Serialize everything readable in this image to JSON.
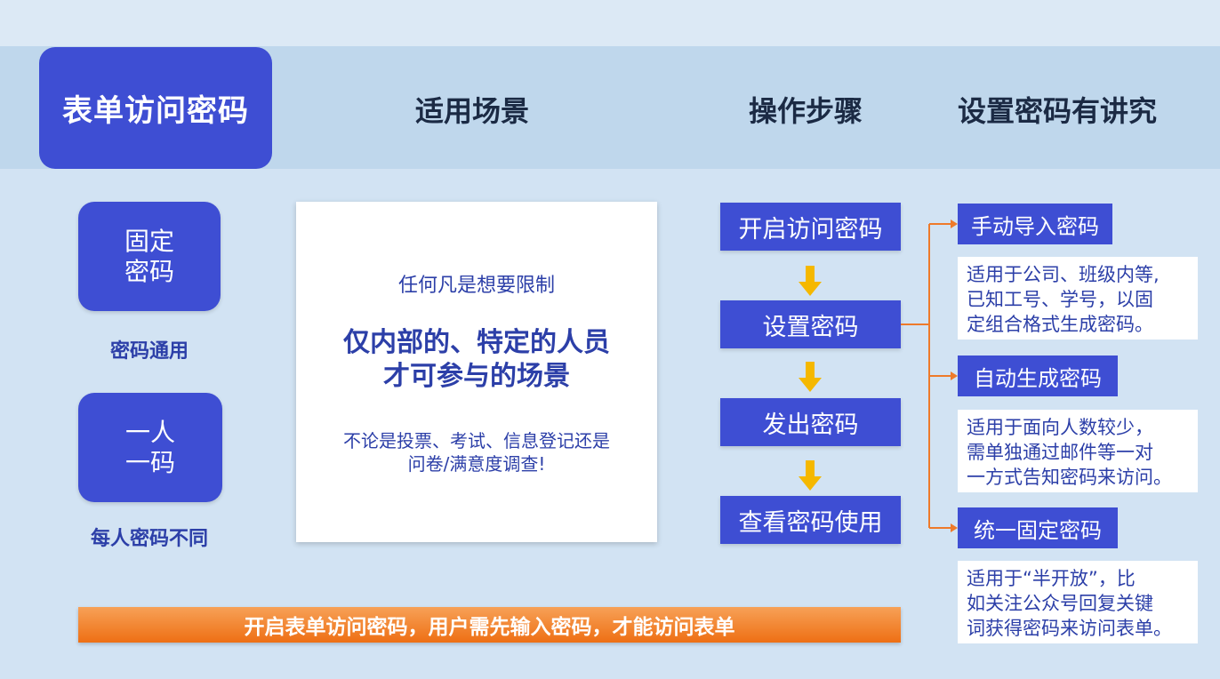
{
  "header": {
    "title": "表单访问密码",
    "columns": [
      "适用场景",
      "操作步骤",
      "设置密码有讲究"
    ]
  },
  "types": [
    {
      "line1": "固定",
      "line2": "密码",
      "caption": "密码通用"
    },
    {
      "line1": "一人",
      "line2": "一码",
      "caption": "每人密码不同"
    }
  ],
  "scene": {
    "line1": "任何凡是想要限制",
    "emph1": "仅内部的、特定的人员",
    "emph2": "才可参与的场景",
    "sub1": "不论是投票、考试、信息登记还是",
    "sub2": "问卷/满意度调查!"
  },
  "steps": [
    "开启访问密码",
    "设置密码",
    "发出密码",
    "查看密码使用"
  ],
  "methods": [
    {
      "label": "手动导入密码",
      "desc": [
        "适用于公司、班级内等,",
        "已知工号、学号，以固",
        "定组合格式生成密码。"
      ]
    },
    {
      "label": "自动生成密码",
      "desc": [
        "适用于面向人数较少，",
        "需单独通过邮件等一对",
        "一方式告知密码来访问。"
      ]
    },
    {
      "label": "统一固定密码",
      "desc": [
        "适用于“半开放”，比",
        "如关注公众号回复关键",
        "词获得密码来访问表单。"
      ]
    }
  ],
  "footer": "开启表单访问密码，用户需先输入密码，才能访问表单",
  "colors": {
    "primary": "#3e4ed3",
    "accent_orange": "#ee6f14",
    "arrow_yellow": "#f5b800",
    "text_blue": "#2c3fa8"
  }
}
